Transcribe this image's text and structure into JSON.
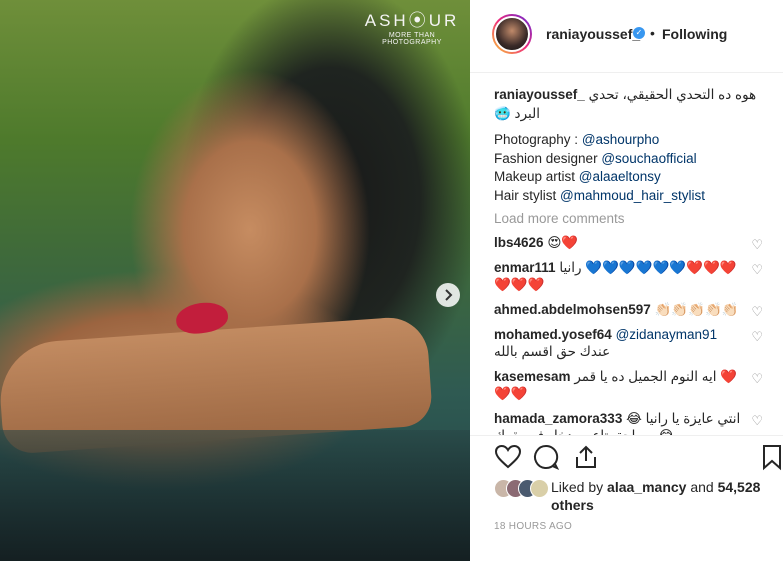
{
  "watermark": {
    "brand": "ASH⦿UR",
    "tagline": "MORE THAN PHOTOGRAPHY"
  },
  "header": {
    "username": "raniayoussef_",
    "verified_glyph": "✓",
    "separator": "•",
    "follow_status": "Following"
  },
  "caption": {
    "username": "raniayoussef_",
    "text": "هوه ده التحدي الحقيقي، تحدي البرد 🥶",
    "credits": [
      {
        "label": "Photography : ",
        "handle": "@ashourpho"
      },
      {
        "label": "Fashion designer ",
        "handle": "@souchaofficial"
      },
      {
        "label": "Makeup artist ",
        "handle": "@alaaeltonsy"
      },
      {
        "label": "Hair stylist ",
        "handle": "@mahmoud_hair_stylist"
      }
    ]
  },
  "load_more": "Load more comments",
  "comments": [
    {
      "username": "lbs4626",
      "mention": "",
      "text": "😍❤️"
    },
    {
      "username": "enmar111",
      "mention": "",
      "text": "رانيا 💙💙💙💙💙💙❤️❤️❤️❤️❤️❤️"
    },
    {
      "username": "ahmed.abdelmohsen597",
      "mention": "",
      "text": "👏🏻👏🏻👏🏻👏🏻👏🏻"
    },
    {
      "username": "mohamed.yosef64",
      "mention": "@zidanayman91",
      "text": "عندك حق اقسم بالله"
    },
    {
      "username": "kasemesam",
      "mention": "",
      "text": "ايه النوم الجميل ده يا قمر ❤️❤️❤️"
    },
    {
      "username": "hamada_zamora333",
      "mention": "",
      "text": "انتي عايزة يا رانيا 😂😂بصراحة بتاعي بدخل في بقوك"
    }
  ],
  "icons": {
    "heart": "heart-icon",
    "comment": "comment-icon",
    "share": "share-icon",
    "save": "bookmark-icon",
    "next": "chevron-right-icon"
  },
  "likes": {
    "prefix": "Liked by ",
    "user": "alaa_mancy",
    "middle": " and ",
    "count": "54,528 others"
  },
  "timestamp": "18 HOURS AGO",
  "colors": {
    "link": "#003569",
    "verified": "#3897f0",
    "muted": "#999999"
  }
}
